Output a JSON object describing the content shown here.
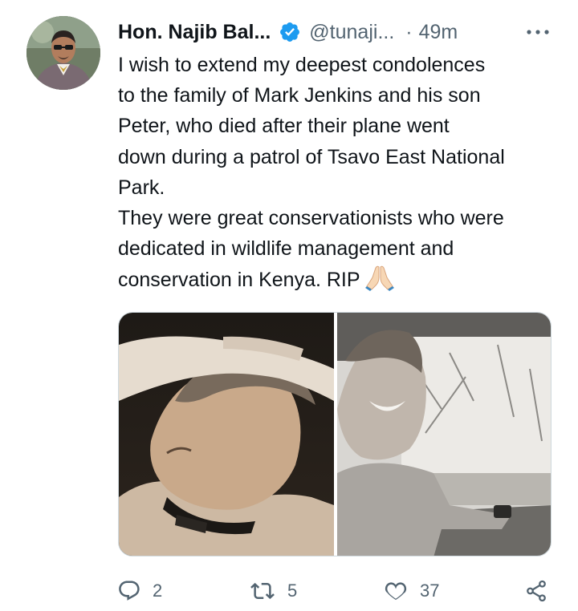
{
  "tweet": {
    "author_name": "Hon. Najib Bal...",
    "handle": "@tunaji...",
    "separator": "·",
    "time": "49m",
    "text_lines": [
      "I wish to extend my deepest condolences",
      "to the family of Mark Jenkins and his son",
      "Peter, who died after their plane went",
      "down during a patrol of Tsavo East National",
      "Park.",
      "They were great conservationists who were",
      "dedicated in wildlife management and",
      "conservation in Kenya. RIP"
    ],
    "emoji": "folded-hands-icon",
    "verified_color": "#1d9bf0"
  },
  "media": {
    "photos": [
      {
        "name": "photo-man-hands-on-head"
      },
      {
        "name": "photo-young-man-in-car"
      }
    ]
  },
  "actions": {
    "reply_count": "2",
    "retweet_count": "5",
    "like_count": "37"
  },
  "colors": {
    "text": "#0f1419",
    "secondary": "#536471",
    "accent": "#1d9bf0"
  }
}
